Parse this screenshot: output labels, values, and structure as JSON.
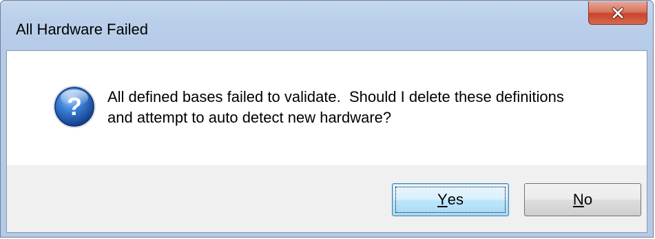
{
  "window": {
    "title": "All Hardware Failed"
  },
  "icons": {
    "close": "close-icon",
    "message": "question-icon"
  },
  "message": {
    "line1": "All defined bases failed to validate.  Should I delete these definitions",
    "line2": "and attempt to auto detect new hardware?"
  },
  "buttons": {
    "yes": {
      "mnemonic": "Y",
      "rest": "es"
    },
    "no": {
      "mnemonic": "N",
      "rest": "o"
    }
  },
  "colors": {
    "titlebar": "#b9cfea",
    "close_button": "#c8452b",
    "question_icon": "#1e5aa8",
    "default_button_border": "#3c7fb1"
  }
}
